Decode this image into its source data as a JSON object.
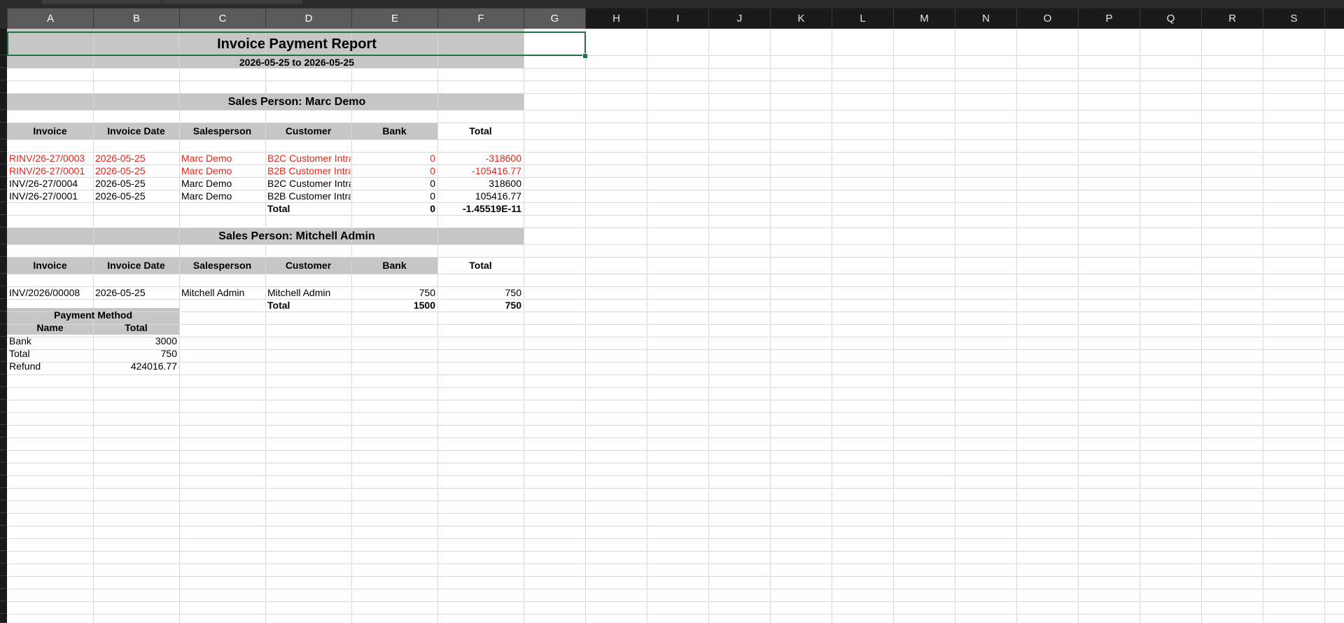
{
  "columns": [
    "A",
    "B",
    "C",
    "D",
    "E",
    "F",
    "G",
    "H",
    "I",
    "J",
    "K",
    "L",
    "M",
    "N",
    "O",
    "P",
    "Q",
    "R",
    "S"
  ],
  "report": {
    "title": "Invoice Payment Report",
    "date_range": "2026-05-25 to 2026-05-25"
  },
  "section1": {
    "heading": "Sales Person: Marc Demo",
    "headers": [
      "Invoice",
      "Invoice Date",
      "Salesperson",
      "Customer",
      "Bank",
      "Total"
    ],
    "rows": [
      [
        "RINV/26-27/0003",
        "2026-05-25",
        "Marc Demo",
        "B2C Customer Intra",
        "0",
        "-318600"
      ],
      [
        "RINV/26-27/0001",
        "2026-05-25",
        "Marc Demo",
        "B2B Customer Intra",
        "0",
        "-105416.77"
      ],
      [
        "INV/26-27/0004",
        "2026-05-25",
        "Marc Demo",
        "B2C Customer Intra",
        "0",
        "318600"
      ],
      [
        "INV/26-27/0001",
        "2026-05-25",
        "Marc Demo",
        "B2B Customer Intra",
        "0",
        "105416.77"
      ]
    ],
    "total_label": "Total",
    "total_bank": "0",
    "total_total": "-1.45519E-11"
  },
  "section2": {
    "heading": "Sales Person: Mitchell Admin",
    "headers": [
      "Invoice",
      "Invoice Date",
      "Salesperson",
      "Customer",
      "Bank",
      "Total"
    ],
    "rows": [
      [
        "INV/2026/00008",
        "2026-05-25",
        "Mitchell Admin",
        "Mitchell Admin",
        "750",
        "750"
      ]
    ],
    "total_label": "Total",
    "total_bank": "1500",
    "total_total": "750"
  },
  "payment_method": {
    "heading": "Payment Method",
    "col_name": "Name",
    "col_total": "Total",
    "rows": [
      [
        "Bank",
        "3000"
      ],
      [
        "Total",
        "750"
      ],
      [
        "Refund",
        "424016.77"
      ]
    ]
  },
  "colors": {
    "header_band": "#c6c6c6",
    "refund_text": "#e0251b",
    "selection": "#217346"
  }
}
